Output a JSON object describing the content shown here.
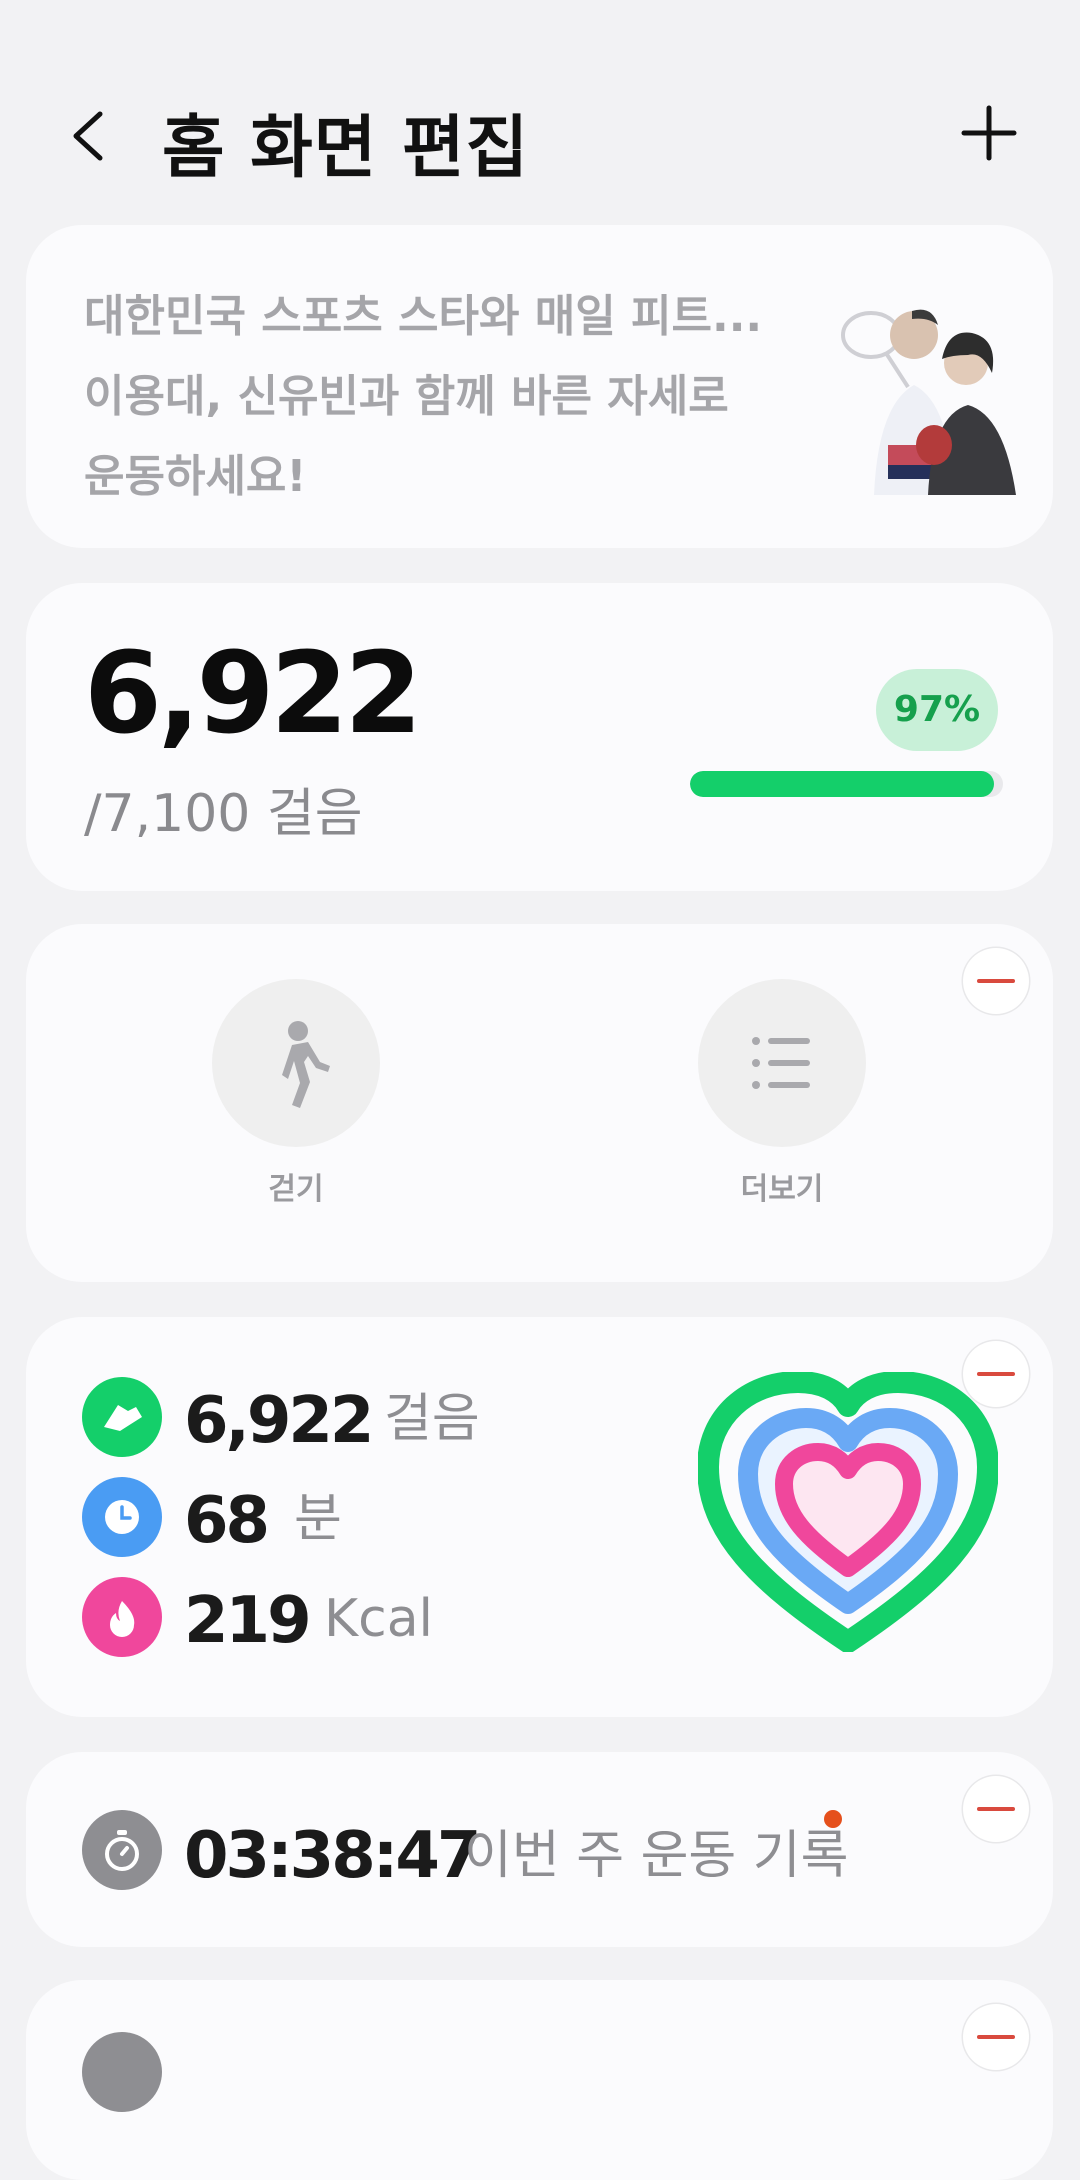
{
  "header": {
    "title": "홈 화면 편집"
  },
  "promo": {
    "line1": "대한민국 스포츠 스타와 매일 피트...",
    "line2": "이용대, 신유빈과 함께 바른 자세로",
    "line3": "운동하세요!"
  },
  "steps": {
    "count": "6,922",
    "goal": "/7,100 걸음",
    "percent_label": "97%",
    "progress": 0.97
  },
  "shortcuts": {
    "items": [
      {
        "label": "걷기",
        "icon": "walking-person-icon"
      },
      {
        "label": "더보기",
        "icon": "list-icon"
      }
    ]
  },
  "activity": {
    "steps_value": "6,922",
    "steps_unit": "걸음",
    "minutes_value": "68",
    "minutes_unit": "분",
    "calories_value": "219",
    "calories_unit": "Kcal"
  },
  "workout": {
    "time": "03:38:47",
    "label": "이번 주 운동 기록"
  },
  "colors": {
    "accent_green": "#14cf6a",
    "accent_blue": "#4a9cf3",
    "accent_pink": "#f0479c",
    "remove_red": "#d94a3e",
    "notification_orange": "#e5501c"
  }
}
